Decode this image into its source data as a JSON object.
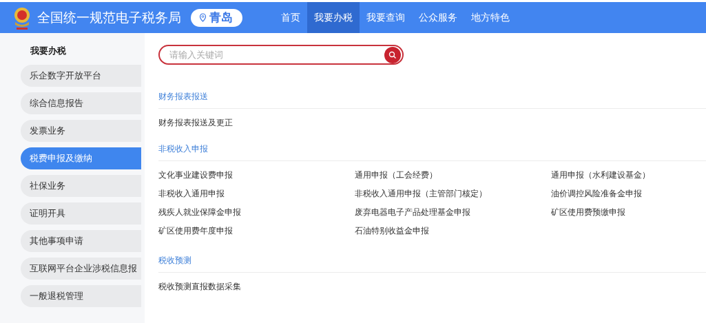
{
  "header": {
    "site_title": "全国统一规范电子税务局",
    "city": "青岛",
    "nav": [
      {
        "label": "首页",
        "selected": false
      },
      {
        "label": "我要办税",
        "selected": true
      },
      {
        "label": "我要查询",
        "selected": false
      },
      {
        "label": "公众服务",
        "selected": false
      },
      {
        "label": "地方特色",
        "selected": false
      }
    ]
  },
  "sidebar": {
    "title": "我要办税",
    "items": [
      {
        "label": "乐企数字开放平台",
        "selected": false
      },
      {
        "label": "综合信息报告",
        "selected": false
      },
      {
        "label": "发票业务",
        "selected": false
      },
      {
        "label": "税费申报及缴纳",
        "selected": true
      },
      {
        "label": "社保业务",
        "selected": false
      },
      {
        "label": "证明开具",
        "selected": false
      },
      {
        "label": "其他事项申请",
        "selected": false
      },
      {
        "label": "互联网平台企业涉税信息报",
        "selected": false
      },
      {
        "label": "一般退税管理",
        "selected": false
      }
    ]
  },
  "search": {
    "placeholder": "请输入关键词"
  },
  "sections": [
    {
      "title": "财务报表报送",
      "links": [
        "财务报表报送及更正"
      ]
    },
    {
      "title": "非税收入申报",
      "links": [
        "文化事业建设费申报",
        "通用申报（工会经费）",
        "通用申报（水利建设基金）",
        "非税收入通用申报",
        "非税收入通用申报（主管部门核定）",
        "油价调控风险准备金申报",
        "残疾人就业保障金申报",
        "废弃电器电子产品处理基金申报",
        "矿区使用费预缴申报",
        "矿区使用费年度申报",
        "石油特别收益金申报"
      ]
    },
    {
      "title": "税收预测",
      "links": [
        "税收预测直报数据采集"
      ]
    }
  ]
}
